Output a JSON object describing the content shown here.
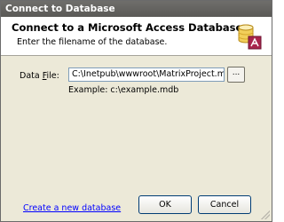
{
  "window": {
    "title": "Connect to Database"
  },
  "header": {
    "title": "Connect to a Microsoft Access Database",
    "subtitle": "Enter the filename of the database.",
    "icon": "database-access-icon"
  },
  "form": {
    "data_file_label_prefix": "Data ",
    "data_file_label_accel": "F",
    "data_file_label_suffix": "ile:",
    "data_file_value": "C:\\Inetpub\\wwwroot\\MatrixProject.mdb",
    "browse_label": "...",
    "example_text": "Example: c:\\example.mdb"
  },
  "footer": {
    "create_link": "Create a new database",
    "ok_label": "OK",
    "cancel_label": "Cancel"
  },
  "colors": {
    "titlebar": "#6f6e6b",
    "dialog_bg": "#ece9d8",
    "link": "#0000ff"
  }
}
